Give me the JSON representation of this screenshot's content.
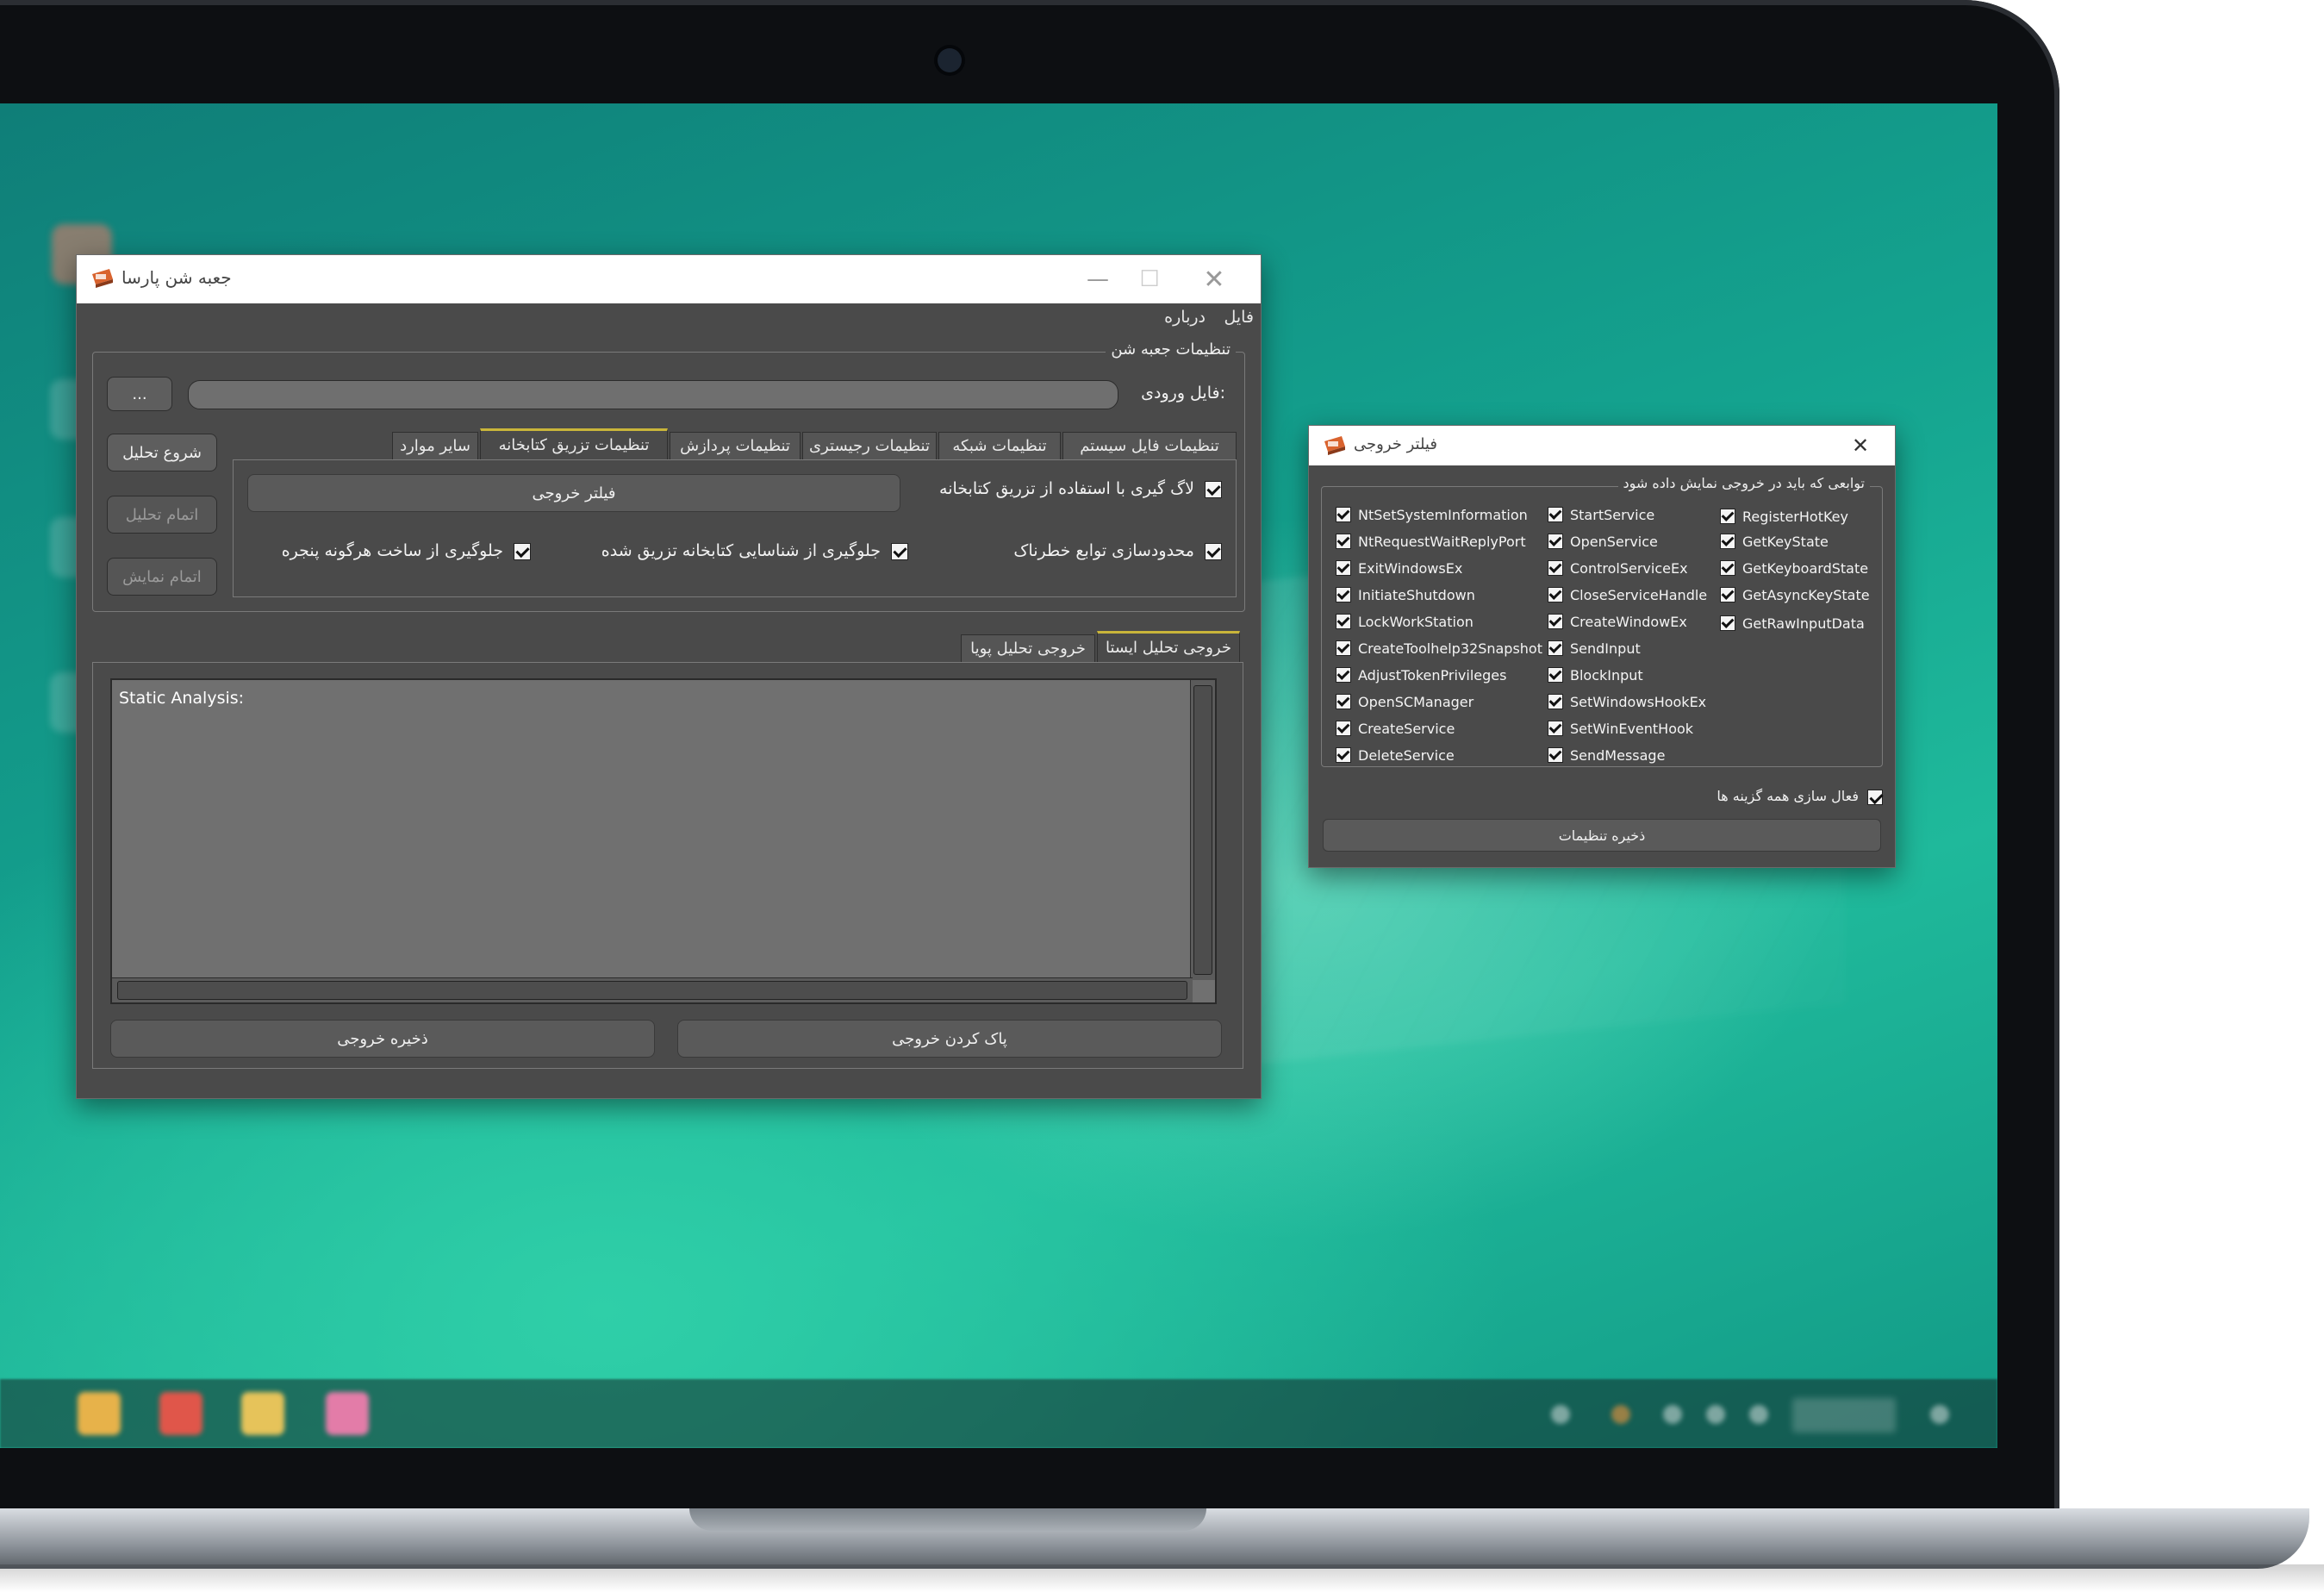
{
  "main_window": {
    "title": "جعبه شن پارسا",
    "menu": {
      "file": "فایل",
      "about": "درباره"
    },
    "sandbox_group": {
      "legend": "تنظیمات جعبه شن",
      "input_file_label": "فایل ورودی:",
      "input_file_value": "",
      "browse_label": "...",
      "start_label": "شروع تحلیل",
      "stop_analysis_label": "اتمام تحلیل",
      "stop_display_label": "اتمام نمایش"
    },
    "settings_tabs": [
      {
        "label": "تنظیمات فایل سیستم"
      },
      {
        "label": "تنظیمات شبکه"
      },
      {
        "label": "تنظیمات رجیستری"
      },
      {
        "label": "تنظیمات پردازش"
      },
      {
        "label": "تنظیمات تزریق کتابخانه"
      },
      {
        "label": "سایر موارد"
      }
    ],
    "injection_panel": {
      "output_filter_button": "فیلتر خروجی",
      "log_injection_label": "لاگ گیری با استفاده از تزریق کتابخانه",
      "restrict_dangerous_label": "محدودسازی توابع خطرناک",
      "prevent_detection_label": "جلوگیری از شناسایی کتابخانه تزریق شده",
      "prevent_window_label": "جلوگیری از ساخت هرگونه پنجره"
    },
    "output_tabs": [
      {
        "label": "خروجی تحلیل ایستا"
      },
      {
        "label": "خروجی تحلیل پویا"
      }
    ],
    "output_text": "Static Analysis:",
    "save_output_label": "ذخیره خروجی",
    "clear_output_label": "پاک کردن خروجی"
  },
  "filter_window": {
    "title": "فیلتر خروجی",
    "legend": "توابعی که باید در خروجی نمایش داده شود",
    "column_1": [
      "NtSetSystemInformation",
      "NtRequestWaitReplyPort",
      "ExitWindowsEx",
      "InitiateShutdown",
      "LockWorkStation",
      "CreateToolhelp32Snapshot",
      "AdjustTokenPrivileges",
      "OpenSCManager",
      "CreateService",
      "DeleteService"
    ],
    "column_2": [
      "StartService",
      "OpenService",
      "ControlServiceEx",
      "CloseServiceHandle",
      "CreateWindowEx",
      "SendInput",
      "BlockInput",
      "SetWindowsHookEx",
      "SetWinEventHook",
      "SendMessage"
    ],
    "column_3": [
      "RegisterHotKey",
      "GetKeyState",
      "GetKeyboardState",
      "GetAsyncKeyState",
      "GetRawInputData"
    ],
    "select_all_label": "فعال سازی همه گزینه ها",
    "save_settings_label": "ذخیره تنظیمات"
  },
  "colors": {
    "active_tab_accent": "#c9b53a",
    "window_bg": "#4a4a4a",
    "desktop_teal": "#14a38f"
  }
}
